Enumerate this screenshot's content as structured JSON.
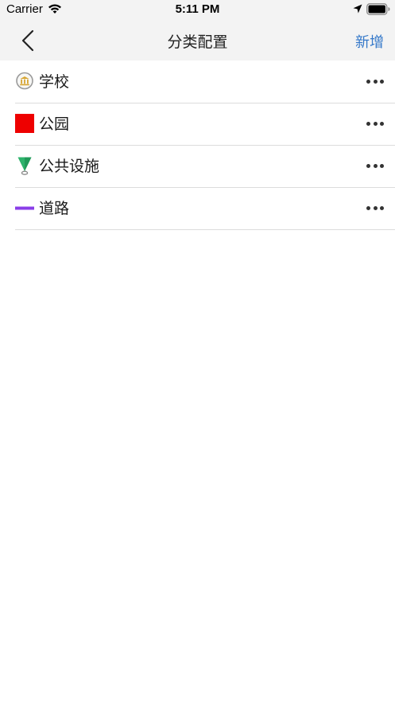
{
  "status_bar": {
    "carrier": "Carrier",
    "time": "5:11 PM",
    "icons": [
      "wifi-icon",
      "location-arrow-icon",
      "battery-icon"
    ]
  },
  "nav": {
    "back_icon": "chevron-left-icon",
    "title": "分类配置",
    "add_label": "新增"
  },
  "categories": [
    {
      "label": "学校",
      "icon": "school-pin-icon",
      "icon_color": "#c89a2a"
    },
    {
      "label": "公园",
      "icon": "red-square-icon",
      "icon_color": "#ee0000"
    },
    {
      "label": "公共设施",
      "icon": "green-marker-icon",
      "icon_color": "#2db36b"
    },
    {
      "label": "道路",
      "icon": "purple-line-icon",
      "icon_color": "#8a3ee8"
    }
  ],
  "colors": {
    "accent": "#3478c9",
    "nav_background": "#f3f3f3",
    "divider": "#dcdcdc"
  }
}
